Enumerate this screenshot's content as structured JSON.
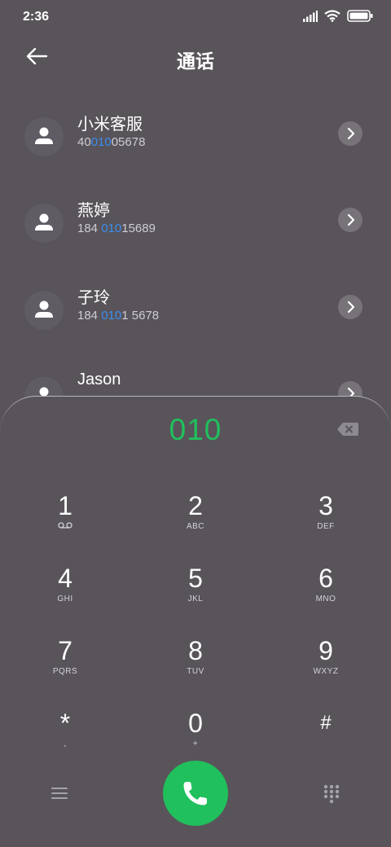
{
  "status_bar": {
    "time": "2:36",
    "icons": [
      "signal-icon",
      "wifi-icon",
      "battery-icon"
    ]
  },
  "header": {
    "title": "通话",
    "back_icon": "arrow-left-icon"
  },
  "contacts": [
    {
      "name": "小米客服",
      "number_pre": "40",
      "number_match": "010",
      "number_post": "05678"
    },
    {
      "name": "燕婷",
      "number_pre": "184 ",
      "number_match": "010",
      "number_post": "15689"
    },
    {
      "name": "子玲",
      "number_pre": "184 ",
      "number_match": "010",
      "number_post": "1 5678"
    },
    {
      "name": "Jason",
      "number_pre": "",
      "number_match": "",
      "number_post": ""
    }
  ],
  "dialpad": {
    "input": "010",
    "keys": [
      {
        "digit": "1",
        "sub": "voicemail-icon"
      },
      {
        "digit": "2",
        "sub": "ABC"
      },
      {
        "digit": "3",
        "sub": "DEF"
      },
      {
        "digit": "4",
        "sub": "GHI"
      },
      {
        "digit": "5",
        "sub": "JKL"
      },
      {
        "digit": "6",
        "sub": "MNO"
      },
      {
        "digit": "7",
        "sub": "PQRS"
      },
      {
        "digit": "8",
        "sub": "TUV"
      },
      {
        "digit": "9",
        "sub": "WXYZ"
      },
      {
        "digit": "*",
        "sub": ","
      },
      {
        "digit": "0",
        "sub": "+"
      },
      {
        "digit": "#",
        "sub": ""
      }
    ]
  },
  "colors": {
    "background": "#58545a",
    "accent_green": "#20c05c",
    "highlight_blue": "#3b8ef0"
  },
  "bottom_bar": {
    "left_icon": "menu-icon",
    "center_icon": "phone-icon",
    "right_icon": "dialpad-grid-icon"
  }
}
